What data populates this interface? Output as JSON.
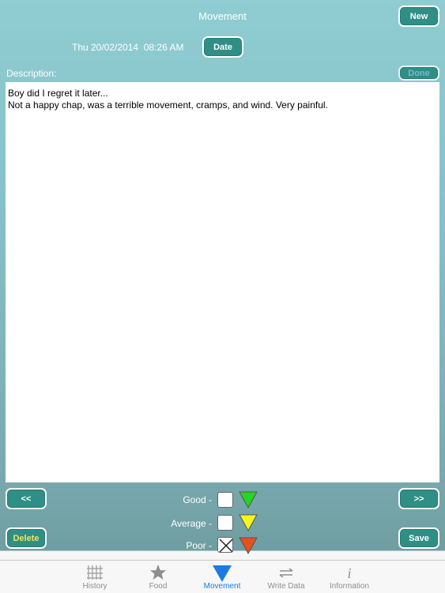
{
  "header": {
    "title": "Movement",
    "new_label": "New"
  },
  "datetime": {
    "value": "Thu 20/02/2014  08:26 AM",
    "date_button": "Date"
  },
  "description": {
    "label": "Description:",
    "done_label": "Done",
    "line1": "Boy did I regret it later...",
    "line2": "Not a happy chap, was a terrible movement, cramps, and wind. Very painful."
  },
  "nav": {
    "prev_label": "<<",
    "next_label": ">>"
  },
  "ratings": {
    "good": {
      "label": "Good -",
      "checked": false,
      "color": "#22d622"
    },
    "average": {
      "label": "Average -",
      "checked": false,
      "color": "#f4f41e"
    },
    "poor": {
      "label": "Poor -",
      "checked": true,
      "color": "#e8501c"
    }
  },
  "actions": {
    "delete_label": "Delete",
    "save_label": "Save"
  },
  "tabs": [
    {
      "label": "History",
      "icon": "history-icon",
      "active": false
    },
    {
      "label": "Food",
      "icon": "star-icon",
      "active": false
    },
    {
      "label": "Movement",
      "icon": "triangle-down-icon",
      "active": true
    },
    {
      "label": "Write Data",
      "icon": "arrows-icon",
      "active": false
    },
    {
      "label": "Information",
      "icon": "info-icon",
      "active": false
    }
  ],
  "colors": {
    "button_bg": "#2f8f87",
    "accent_blue": "#1c7be0"
  }
}
